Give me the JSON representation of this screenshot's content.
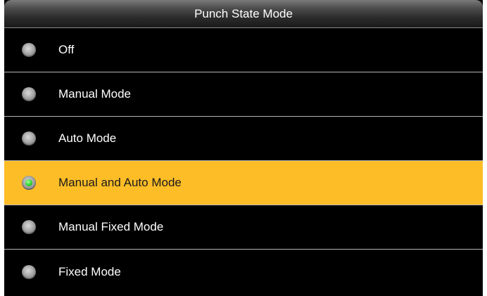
{
  "header": {
    "title": "Punch State Mode"
  },
  "options": [
    {
      "label": "Off",
      "selected": false
    },
    {
      "label": "Manual Mode",
      "selected": false
    },
    {
      "label": "Auto Mode",
      "selected": false
    },
    {
      "label": "Manual and Auto Mode",
      "selected": true
    },
    {
      "label": "Manual Fixed Mode",
      "selected": false
    },
    {
      "label": "Fixed Mode",
      "selected": false
    }
  ],
  "colors": {
    "background": "#000000",
    "highlight": "#fdbd27",
    "text": "#ffffff",
    "selected_text": "#1a1a1a",
    "divider": "#b5b5b5",
    "radio_selected_dot": "#2fd42c"
  },
  "icons": {
    "radio_unselected": "radio-button-unselected-icon",
    "radio_selected": "radio-button-selected-icon"
  }
}
